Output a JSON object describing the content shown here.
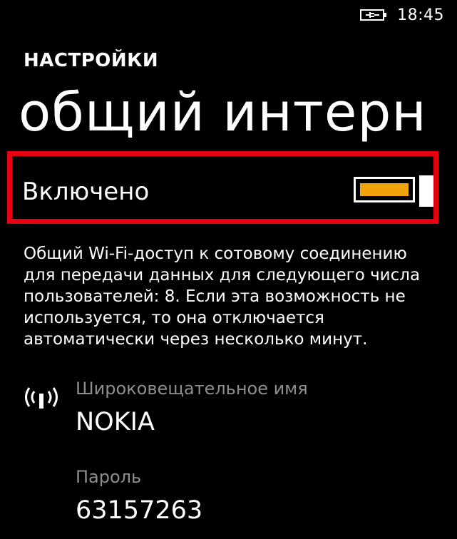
{
  "status_bar": {
    "battery_icon": "battery-charging-icon",
    "time": "18:45"
  },
  "header": {
    "app_title": "НАСТРОЙКИ",
    "page_title": "общий интерн"
  },
  "sharing_toggle": {
    "label": "Включено",
    "state": "on",
    "accent_color": "#f0a30a",
    "highlight_color": "#e60012"
  },
  "description": "Общий Wi-Fi-доступ к сотовому соединению для передачи данных для следующего числа пользователей: 8. Если эта возможность не используется, то она отключается автоматически через несколько минут.",
  "broadcast": {
    "icon": "wifi-broadcast-icon",
    "label": "Широковещательное имя",
    "value": "NOKIA"
  },
  "password": {
    "label": "Пароль",
    "value": "63157263"
  }
}
